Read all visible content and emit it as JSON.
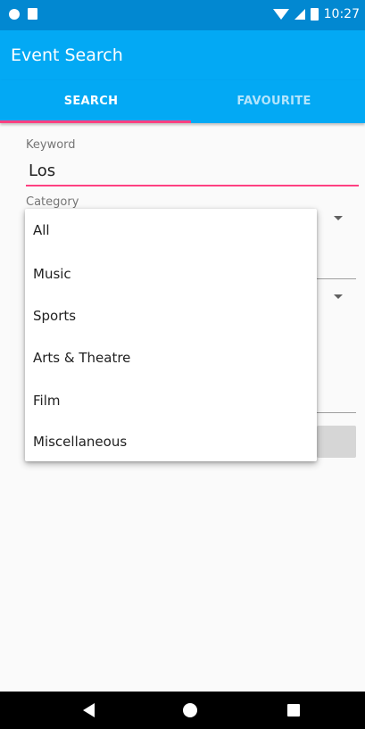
{
  "status_bar": {
    "time": "10:27",
    "icons": [
      "notification-dot-icon",
      "sim-icon",
      "wifi-icon",
      "signal-icon",
      "battery-icon"
    ]
  },
  "app_bar": {
    "title": "Event Search"
  },
  "tabs": [
    {
      "label": "SEARCH",
      "selected": true
    },
    {
      "label": "FAVOURITE",
      "selected": false
    }
  ],
  "form": {
    "keyword_label": "Keyword",
    "keyword_value": "Los",
    "category_label": "Category"
  },
  "category_dropdown": {
    "open": true,
    "options": [
      "All",
      "Music",
      "Sports",
      "Arts & Theatre",
      "Film",
      "Miscellaneous"
    ]
  },
  "colors": {
    "status_bar": "#0288d1",
    "primary": "#03a9f4",
    "accent": "#ff4081"
  },
  "nav_bar": {
    "icons": [
      "back-icon",
      "home-icon",
      "recents-icon"
    ]
  }
}
